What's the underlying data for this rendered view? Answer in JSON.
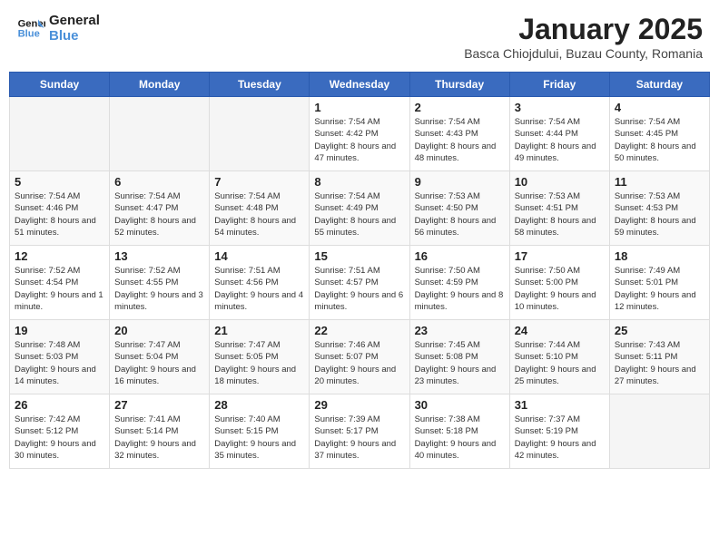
{
  "header": {
    "logo_line1": "General",
    "logo_line2": "Blue",
    "month": "January 2025",
    "location": "Basca Chiojdului, Buzau County, Romania"
  },
  "weekdays": [
    "Sunday",
    "Monday",
    "Tuesday",
    "Wednesday",
    "Thursday",
    "Friday",
    "Saturday"
  ],
  "weeks": [
    [
      {
        "day": "",
        "info": ""
      },
      {
        "day": "",
        "info": ""
      },
      {
        "day": "",
        "info": ""
      },
      {
        "day": "1",
        "info": "Sunrise: 7:54 AM\nSunset: 4:42 PM\nDaylight: 8 hours and 47 minutes."
      },
      {
        "day": "2",
        "info": "Sunrise: 7:54 AM\nSunset: 4:43 PM\nDaylight: 8 hours and 48 minutes."
      },
      {
        "day": "3",
        "info": "Sunrise: 7:54 AM\nSunset: 4:44 PM\nDaylight: 8 hours and 49 minutes."
      },
      {
        "day": "4",
        "info": "Sunrise: 7:54 AM\nSunset: 4:45 PM\nDaylight: 8 hours and 50 minutes."
      }
    ],
    [
      {
        "day": "5",
        "info": "Sunrise: 7:54 AM\nSunset: 4:46 PM\nDaylight: 8 hours and 51 minutes."
      },
      {
        "day": "6",
        "info": "Sunrise: 7:54 AM\nSunset: 4:47 PM\nDaylight: 8 hours and 52 minutes."
      },
      {
        "day": "7",
        "info": "Sunrise: 7:54 AM\nSunset: 4:48 PM\nDaylight: 8 hours and 54 minutes."
      },
      {
        "day": "8",
        "info": "Sunrise: 7:54 AM\nSunset: 4:49 PM\nDaylight: 8 hours and 55 minutes."
      },
      {
        "day": "9",
        "info": "Sunrise: 7:53 AM\nSunset: 4:50 PM\nDaylight: 8 hours and 56 minutes."
      },
      {
        "day": "10",
        "info": "Sunrise: 7:53 AM\nSunset: 4:51 PM\nDaylight: 8 hours and 58 minutes."
      },
      {
        "day": "11",
        "info": "Sunrise: 7:53 AM\nSunset: 4:53 PM\nDaylight: 8 hours and 59 minutes."
      }
    ],
    [
      {
        "day": "12",
        "info": "Sunrise: 7:52 AM\nSunset: 4:54 PM\nDaylight: 9 hours and 1 minute."
      },
      {
        "day": "13",
        "info": "Sunrise: 7:52 AM\nSunset: 4:55 PM\nDaylight: 9 hours and 3 minutes."
      },
      {
        "day": "14",
        "info": "Sunrise: 7:51 AM\nSunset: 4:56 PM\nDaylight: 9 hours and 4 minutes."
      },
      {
        "day": "15",
        "info": "Sunrise: 7:51 AM\nSunset: 4:57 PM\nDaylight: 9 hours and 6 minutes."
      },
      {
        "day": "16",
        "info": "Sunrise: 7:50 AM\nSunset: 4:59 PM\nDaylight: 9 hours and 8 minutes."
      },
      {
        "day": "17",
        "info": "Sunrise: 7:50 AM\nSunset: 5:00 PM\nDaylight: 9 hours and 10 minutes."
      },
      {
        "day": "18",
        "info": "Sunrise: 7:49 AM\nSunset: 5:01 PM\nDaylight: 9 hours and 12 minutes."
      }
    ],
    [
      {
        "day": "19",
        "info": "Sunrise: 7:48 AM\nSunset: 5:03 PM\nDaylight: 9 hours and 14 minutes."
      },
      {
        "day": "20",
        "info": "Sunrise: 7:47 AM\nSunset: 5:04 PM\nDaylight: 9 hours and 16 minutes."
      },
      {
        "day": "21",
        "info": "Sunrise: 7:47 AM\nSunset: 5:05 PM\nDaylight: 9 hours and 18 minutes."
      },
      {
        "day": "22",
        "info": "Sunrise: 7:46 AM\nSunset: 5:07 PM\nDaylight: 9 hours and 20 minutes."
      },
      {
        "day": "23",
        "info": "Sunrise: 7:45 AM\nSunset: 5:08 PM\nDaylight: 9 hours and 23 minutes."
      },
      {
        "day": "24",
        "info": "Sunrise: 7:44 AM\nSunset: 5:10 PM\nDaylight: 9 hours and 25 minutes."
      },
      {
        "day": "25",
        "info": "Sunrise: 7:43 AM\nSunset: 5:11 PM\nDaylight: 9 hours and 27 minutes."
      }
    ],
    [
      {
        "day": "26",
        "info": "Sunrise: 7:42 AM\nSunset: 5:12 PM\nDaylight: 9 hours and 30 minutes."
      },
      {
        "day": "27",
        "info": "Sunrise: 7:41 AM\nSunset: 5:14 PM\nDaylight: 9 hours and 32 minutes."
      },
      {
        "day": "28",
        "info": "Sunrise: 7:40 AM\nSunset: 5:15 PM\nDaylight: 9 hours and 35 minutes."
      },
      {
        "day": "29",
        "info": "Sunrise: 7:39 AM\nSunset: 5:17 PM\nDaylight: 9 hours and 37 minutes."
      },
      {
        "day": "30",
        "info": "Sunrise: 7:38 AM\nSunset: 5:18 PM\nDaylight: 9 hours and 40 minutes."
      },
      {
        "day": "31",
        "info": "Sunrise: 7:37 AM\nSunset: 5:19 PM\nDaylight: 9 hours and 42 minutes."
      },
      {
        "day": "",
        "info": ""
      }
    ]
  ]
}
